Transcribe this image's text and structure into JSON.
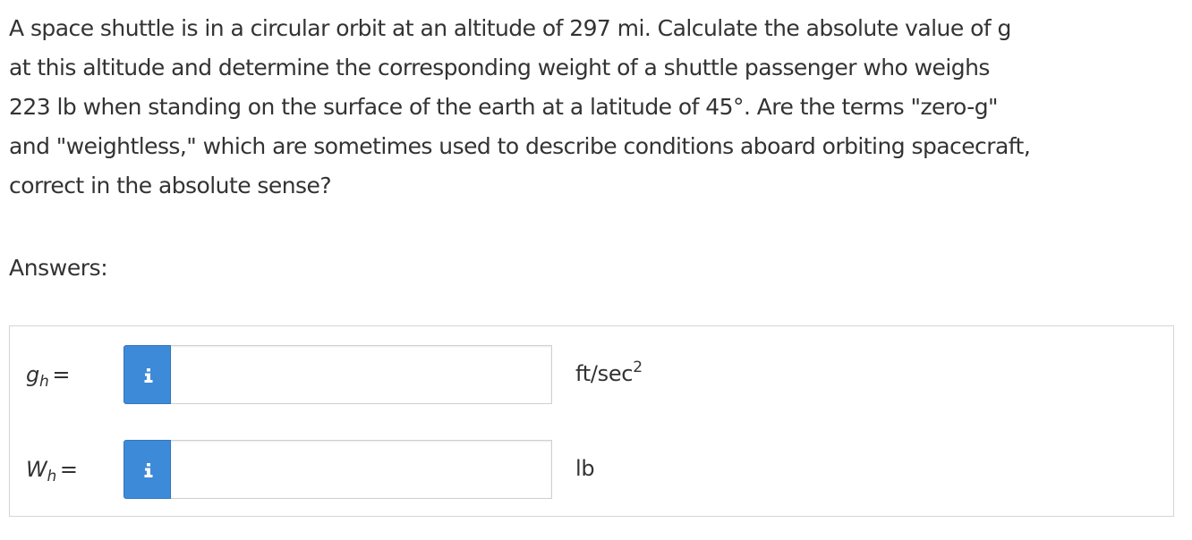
{
  "question": {
    "lines": [
      "A space shuttle is in a circular orbit at an altitude of 297 mi. Calculate the absolute value of g",
      "at this altitude and determine the corresponding weight of a shuttle passenger who weighs",
      "223 lb when standing on the surface of the earth at a latitude of 45°. Are the terms \"zero-g\"",
      "and \"weightless,\" which are sometimes used to describe conditions aboard orbiting spacecraft,",
      "correct in the absolute sense?"
    ]
  },
  "answers_label": "Answers:",
  "answers": [
    {
      "symbol": "g",
      "subscript": "h",
      "equals": "=",
      "icon": "info-icon",
      "value": "",
      "placeholder": "",
      "unit": "ft/sec",
      "unit_superscript": "2"
    },
    {
      "symbol": "W",
      "subscript": "h",
      "equals": "=",
      "icon": "info-icon",
      "value": "",
      "placeholder": "",
      "unit": "lb",
      "unit_superscript": ""
    }
  ],
  "colors": {
    "info_button": "#3d8ad8",
    "text": "#333333",
    "border": "#d5d5d5"
  }
}
